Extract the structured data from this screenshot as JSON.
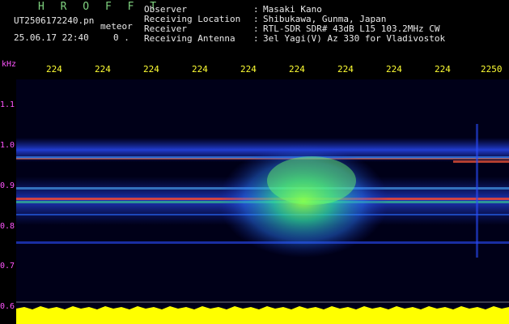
{
  "header": {
    "title": "H R O F F T",
    "filename": "UT2506172240.pn",
    "tag": "meteor",
    "timestamp": "25.06.17 22:40",
    "counter": "0 ."
  },
  "meta": [
    {
      "key": "Observer",
      "value": "Masaki Kano"
    },
    {
      "key": "Receiving Location",
      "value": "Shibukawa, Gunma, Japan"
    },
    {
      "key": "Receiver",
      "value": "RTL-SDR SDR# 43dB L15 103.2MHz CW"
    },
    {
      "key": "Receiving Antenna",
      "value": "3el Yagi(V) Az 330 for Vladivostok"
    }
  ],
  "axes": {
    "y_unit": "kHz",
    "y_ticks": [
      "1.1",
      "1.0",
      "0.9",
      "0.8",
      "0.7",
      "0.6"
    ],
    "x_ticks": [
      "224",
      "224",
      "224",
      "224",
      "224",
      "224",
      "224",
      "224",
      "224",
      "2250"
    ]
  },
  "colors": {
    "header_green": "#7fd27f",
    "text": "#e9e9e9",
    "axis_magenta": "#ff55ff",
    "tick_yellow": "#ffff33",
    "amplitude_yellow": "#ffff00",
    "background": "#000010"
  }
}
